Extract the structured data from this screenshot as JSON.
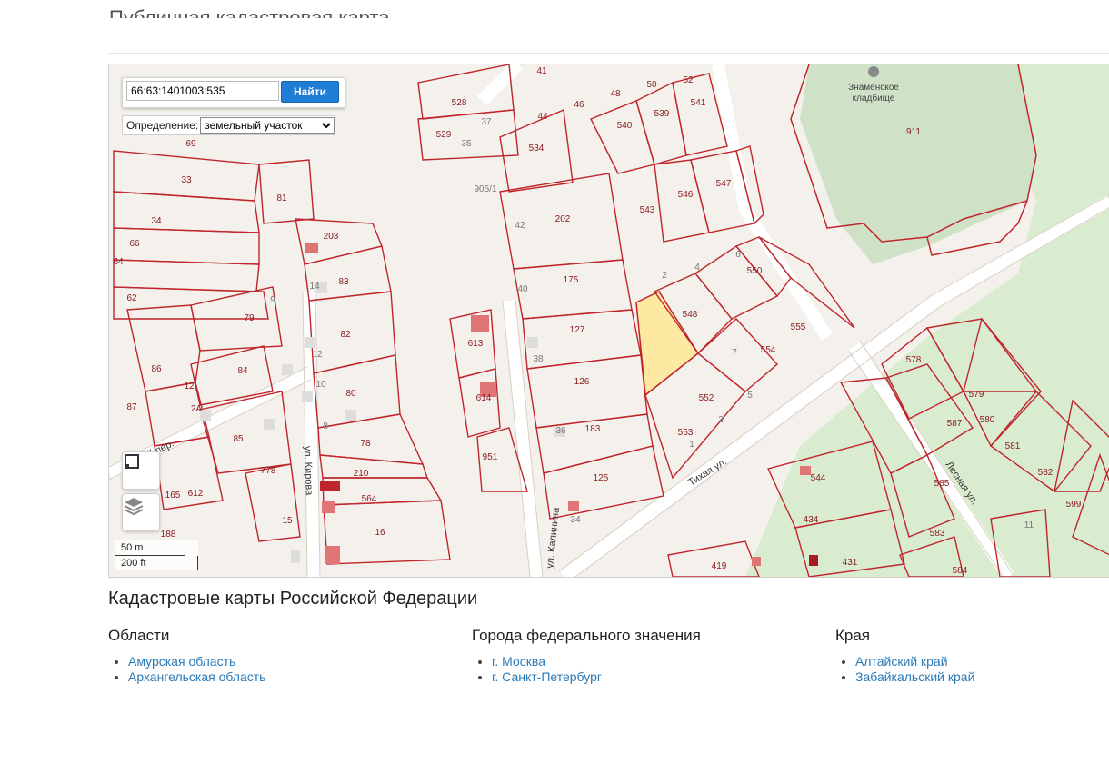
{
  "page": {
    "title": "Публичная кадастровая карта",
    "section_title": "Кадастровые карты Российской Федерации"
  },
  "search": {
    "value": "66:63:1401003:535",
    "button_label": "Найти",
    "definition_label": "Определение:",
    "definition_value": "земельный участок",
    "definition_options": [
      "земельный участок"
    ]
  },
  "map": {
    "selected_parcel": "535",
    "selected_color": "#fde9a2",
    "boundary_color": "#c0252b",
    "cemetery_color": "#cfe2c7",
    "scale_metric": "50 m",
    "scale_imperial": "200 ft",
    "poi": {
      "name_line1": "Знаменское",
      "name_line2": "кладбище"
    },
    "streets": [
      "ул. Кирова",
      "ул. Калинина",
      "Тихая ул.",
      "Лесная ул.",
      "ский пер."
    ],
    "parcel_labels": [
      "69",
      "33",
      "34",
      "66",
      "64",
      "62",
      "81",
      "203",
      "83",
      "82",
      "80",
      "78",
      "210",
      "564",
      "16",
      "75",
      "79",
      "86",
      "84",
      "12",
      "2А",
      "87",
      "85",
      "778",
      "15",
      "612",
      "165",
      "188",
      "528",
      "529",
      "534",
      "41",
      "44",
      "46",
      "48",
      "50",
      "52",
      "540",
      "539",
      "541",
      "543",
      "546",
      "547",
      "202",
      "175",
      "127",
      "126",
      "183",
      "125",
      "613",
      "614",
      "951",
      "550",
      "548",
      "555",
      "554",
      "552",
      "553",
      "911",
      "578",
      "579",
      "580",
      "581",
      "582",
      "599",
      "587",
      "585",
      "583",
      "584",
      "544",
      "434",
      "431",
      "419"
    ],
    "parcel_numbers_small": [
      "37",
      "35",
      "42",
      "905/1",
      "40",
      "38",
      "36",
      "34",
      "14",
      "12",
      "10",
      "8",
      "9",
      "7",
      "5",
      "1",
      "2",
      "3",
      "4",
      "6",
      "11"
    ]
  },
  "columns": [
    {
      "heading": "Области",
      "links": [
        "Амурская область",
        "Архангельская область"
      ]
    },
    {
      "heading": "Города федерального значения",
      "links": [
        "г. Москва",
        "г. Санкт-Петербург"
      ]
    },
    {
      "heading": "Края",
      "links": [
        "Алтайский край",
        "Забайкальский край"
      ]
    }
  ]
}
